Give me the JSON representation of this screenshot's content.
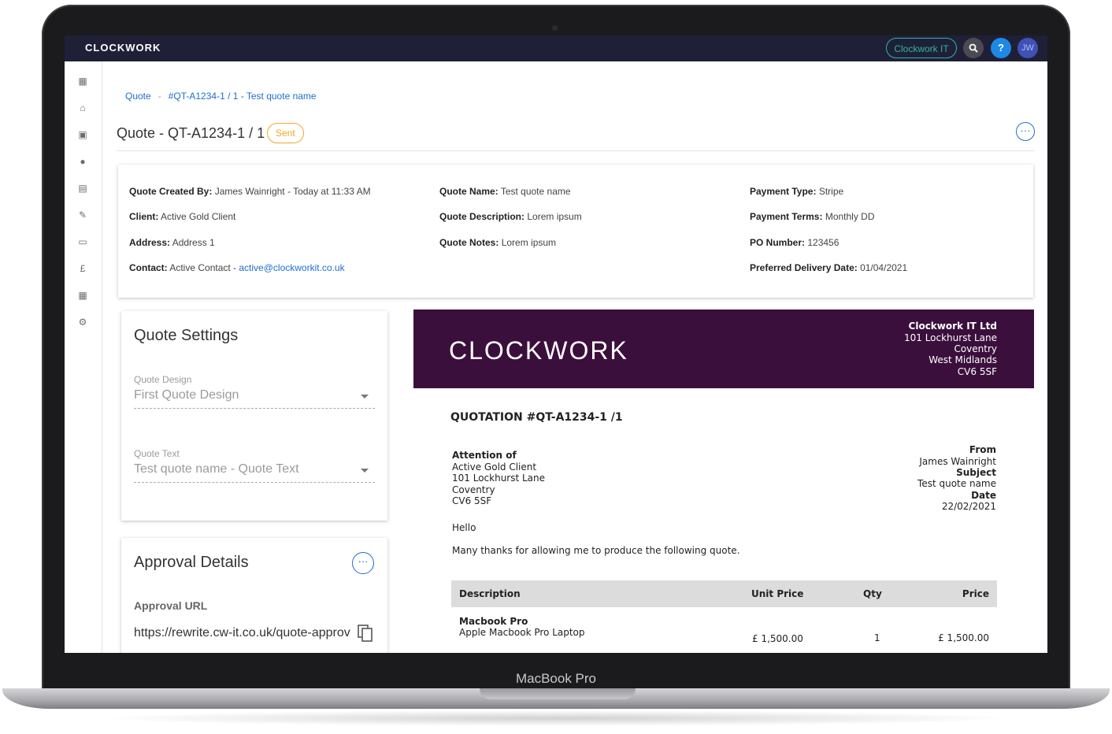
{
  "device": {
    "model": "MacBook Pro"
  },
  "topbar": {
    "brand": "CLOCKWORK",
    "company": "Clockwork IT",
    "search_icon": "search-icon",
    "help_label": "?",
    "avatar_initials": "JW"
  },
  "sidebar": {
    "items": [
      {
        "icon": "dashboard-icon",
        "glyph": "▦"
      },
      {
        "icon": "home-icon",
        "glyph": "⌂"
      },
      {
        "icon": "ticket-icon",
        "glyph": "▣"
      },
      {
        "icon": "person-icon",
        "glyph": "●"
      },
      {
        "icon": "contacts-icon",
        "glyph": "▤"
      },
      {
        "icon": "edit-document-icon",
        "glyph": "✎"
      },
      {
        "icon": "monitor-icon",
        "glyph": "▭"
      },
      {
        "icon": "pound-icon",
        "glyph": "£"
      },
      {
        "icon": "calendar-icon",
        "glyph": "▦"
      },
      {
        "icon": "gear-icon",
        "glyph": "⚙"
      }
    ]
  },
  "breadcrumb": {
    "item1": "Quote",
    "separator": "-",
    "item2": "#QT-A1234-1 / 1 - Test quote name"
  },
  "page": {
    "title": "Quote - QT-A1234-1 / 1",
    "status": "Sent",
    "menu_glyph": "···"
  },
  "info": {
    "created_by_label": "Quote Created By:",
    "created_by": "James Wainright - Today at 11:33 AM",
    "client_label": "Client:",
    "client": "Active Gold Client",
    "address_label": "Address:",
    "address": "Address 1",
    "contact_label": "Contact:",
    "contact": "Active Contact - ",
    "contact_email": "active@clockworkit.co.uk",
    "name_label": "Quote Name:",
    "name": "Test quote name",
    "description_label": "Quote Description:",
    "description": "Lorem ipsum",
    "notes_label": "Quote Notes:",
    "notes": "Lorem ipsum",
    "payment_type_label": "Payment Type:",
    "payment_type": "Stripe",
    "payment_terms_label": "Payment Terms:",
    "payment_terms": "Monthly DD",
    "po_label": "PO Number:",
    "po": "123456",
    "delivery_label": "Preferred Delivery Date:",
    "delivery": "01/04/2021"
  },
  "settings": {
    "title": "Quote Settings",
    "design_label": "Quote Design",
    "design_value": "First Quote Design",
    "text_label": "Quote Text",
    "text_value": "Test quote name - Quote Text"
  },
  "approval": {
    "title": "Approval Details",
    "menu_glyph": "···",
    "url_label": "Approval URL",
    "url_value": "https://rewrite.cw-it.co.uk/quote-approv",
    "copy_icon": "copy-icon"
  },
  "doc": {
    "logo": "CLOCKWORK",
    "company_name": "Clockwork IT Ltd",
    "company_addr": [
      "101 Lockhurst Lane",
      "Coventry",
      "West Midlands",
      "CV6 5SF"
    ],
    "heading": "QUOTATION #QT-A1234-1 /1",
    "attention_label": "Attention of",
    "attention": [
      "Active Gold Client",
      "101 Lockhurst Lane",
      "Coventry",
      "CV6 5SF"
    ],
    "from_label": "From",
    "from": "James Wainright",
    "subject_label": "Subject",
    "subject": "Test quote name",
    "date_label": "Date",
    "date": "22/02/2021",
    "greeting": "Hello",
    "intro": "Many thanks for allowing me to produce the following quote.",
    "table": {
      "headers": [
        "Description",
        "Unit Price",
        "Qty",
        "Price"
      ],
      "row": {
        "name": "Macbook Pro",
        "desc": "Apple Macbook Pro Laptop",
        "unit_price": "£ 1,500.00",
        "qty": "1",
        "price": "£ 1,500.00"
      }
    }
  }
}
